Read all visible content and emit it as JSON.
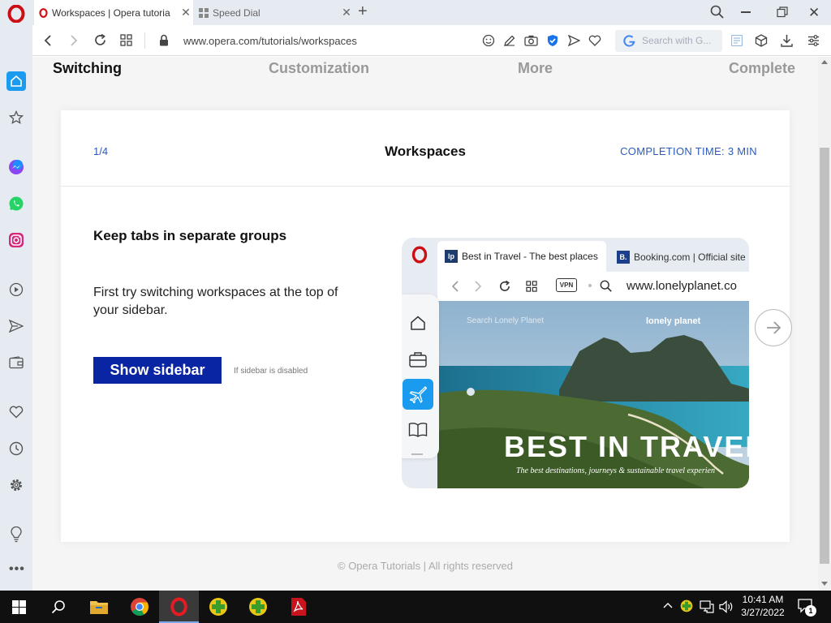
{
  "browser": {
    "tabs": [
      {
        "title": "Workspaces | Opera tutoria",
        "active": true
      },
      {
        "title": "Speed Dial",
        "active": false
      }
    ],
    "url": "www.opera.com/tutorials/workspaces",
    "search_placeholder": "Search with G..."
  },
  "steps": {
    "items": [
      "Switching",
      "Customization",
      "More",
      "Complete"
    ],
    "active": "Switching"
  },
  "card": {
    "progress": "1/4",
    "title": "Workspaces",
    "completion": "COMPLETION TIME: 3 MIN",
    "heading": "Keep tabs in separate groups",
    "body": "First try switching workspaces at the top of your sidebar.",
    "button": "Show sidebar",
    "note": "If sidebar is disabled"
  },
  "preview": {
    "tab1": "Best in Travel - The best places",
    "tab1_icon": "lp",
    "tab2": "Booking.com | Official site",
    "tab2_icon": "B.",
    "vpn": "VPN",
    "url": "www.lonelyplanet.co",
    "search_placeholder": "Search Lonely Planet",
    "logo": "lonely planet",
    "headline": "BEST IN TRAVEL",
    "headline_in": "IN",
    "subline": "The best destinations, journeys & sustainable travel experien"
  },
  "footer": "© Opera Tutorials | All rights reserved",
  "taskbar": {
    "time": "10:41 AM",
    "date": "3/27/2022",
    "notifications": "1"
  },
  "colors": {
    "accent_blue": "#0a25a3",
    "link_blue": "#2d5bb9",
    "opera_red": "#cc0f16"
  }
}
